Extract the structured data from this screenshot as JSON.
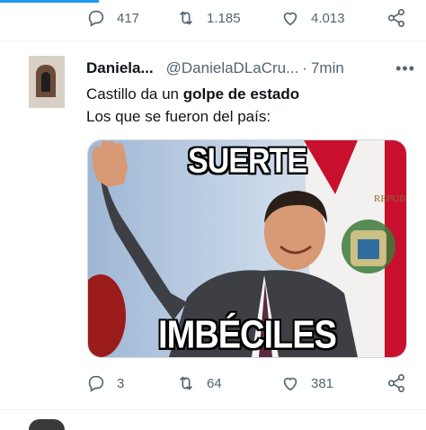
{
  "top_actions": {
    "reply_count": "417",
    "retweet_count": "1.185",
    "like_count": "4.013"
  },
  "tweet": {
    "name": "Daniela...",
    "handle": "@DanielaDLaCru...",
    "separator": "·",
    "time": "7min",
    "text_line1_prefix": "Castillo da un ",
    "text_line1_bold": "golpe de estado",
    "text_line2": "Los que se fueron del país:",
    "meme_top_text": "SUERTE",
    "meme_bottom_text": "IMBÉCILES",
    "flag_text": "REPUBLICA",
    "reply_count": "3",
    "retweet_count": "64",
    "like_count": "381"
  },
  "colors": {
    "accent": "#1d9bf0",
    "muted": "#536471",
    "flag_red": "#c8102e"
  },
  "icons": [
    "reply-icon",
    "retweet-icon",
    "like-icon",
    "share-icon",
    "more-icon"
  ]
}
